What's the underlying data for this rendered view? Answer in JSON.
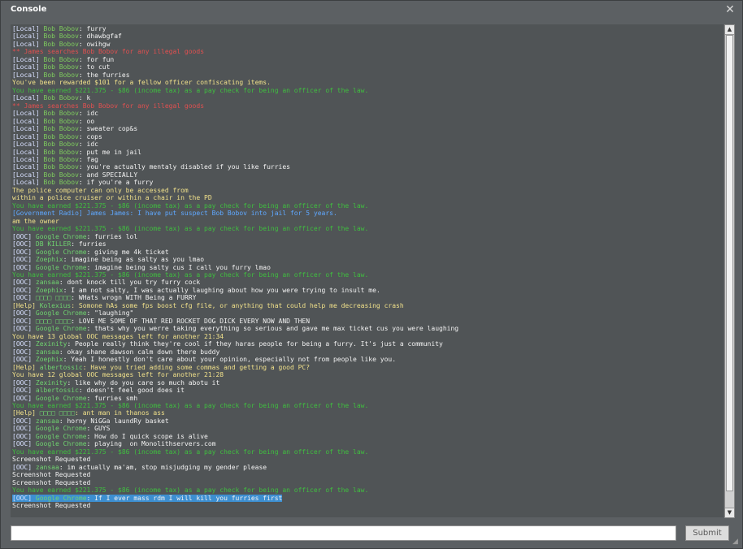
{
  "window": {
    "title": "Console",
    "close_glyph": "✕",
    "resize_glyph": "◢"
  },
  "input": {
    "value": "",
    "placeholder": ""
  },
  "submit": {
    "label": "Submit"
  },
  "scrollbar": {
    "up_glyph": "▲",
    "down_glyph": "▼"
  },
  "colors": {
    "tag": "#d8e0ff",
    "bob": "#7ecb5e",
    "name": "#6fd26f",
    "red": "#e05050",
    "yellow": "#f0e08a",
    "green": "#3fbf3f",
    "blue": "#5fa8ff",
    "white": "#f2f2f2"
  },
  "log": [
    [
      [
        "[Local] ",
        "tag"
      ],
      [
        "Bob Bobov",
        "bob"
      ],
      [
        ": furry",
        "white"
      ]
    ],
    [
      [
        "[Local] ",
        "tag"
      ],
      [
        "Bob Bobov",
        "bob"
      ],
      [
        ": dhawbgfaf",
        "white"
      ]
    ],
    [
      [
        "[Local] ",
        "tag"
      ],
      [
        "Bob Bobov",
        "bob"
      ],
      [
        ": owihgw",
        "white"
      ]
    ],
    [
      [
        "** James searches Bob Bobov for any illegal goods",
        "red"
      ]
    ],
    [
      [
        "[Local] ",
        "tag"
      ],
      [
        "Bob Bobov",
        "bob"
      ],
      [
        ": for fun",
        "white"
      ]
    ],
    [
      [
        "[Local] ",
        "tag"
      ],
      [
        "Bob Bobov",
        "bob"
      ],
      [
        ": to cut",
        "white"
      ]
    ],
    [
      [
        "[Local] ",
        "tag"
      ],
      [
        "Bob Bobov",
        "bob"
      ],
      [
        ": the furries",
        "white"
      ]
    ],
    [
      [
        "You've been rewarded $101 for a fellow officer confiscating items.",
        "yellow"
      ]
    ],
    [
      [
        "You have earned $221.375 - $86 (income tax) as a pay check for being an officer of the law.",
        "green"
      ]
    ],
    [
      [
        "[Local] ",
        "tag"
      ],
      [
        "Bob Bobov",
        "bob"
      ],
      [
        ": k",
        "white"
      ]
    ],
    [
      [
        "** James searches Bob Bobov for any illegal goods",
        "red"
      ]
    ],
    [
      [
        "[Local] ",
        "tag"
      ],
      [
        "Bob Bobov",
        "bob"
      ],
      [
        ": idc",
        "white"
      ]
    ],
    [
      [
        "[Local] ",
        "tag"
      ],
      [
        "Bob Bobov",
        "bob"
      ],
      [
        ": oo",
        "white"
      ]
    ],
    [
      [
        "[Local] ",
        "tag"
      ],
      [
        "Bob Bobov",
        "bob"
      ],
      [
        ": sweater cop&s",
        "white"
      ]
    ],
    [
      [
        "[Local] ",
        "tag"
      ],
      [
        "Bob Bobov",
        "bob"
      ],
      [
        ": cops",
        "white"
      ]
    ],
    [
      [
        "[Local] ",
        "tag"
      ],
      [
        "Bob Bobov",
        "bob"
      ],
      [
        ": idc",
        "white"
      ]
    ],
    [
      [
        "[Local] ",
        "tag"
      ],
      [
        "Bob Bobov",
        "bob"
      ],
      [
        ": put me in jail",
        "white"
      ]
    ],
    [
      [
        "[Local] ",
        "tag"
      ],
      [
        "Bob Bobov",
        "bob"
      ],
      [
        ": fag",
        "white"
      ]
    ],
    [
      [
        "[Local] ",
        "tag"
      ],
      [
        "Bob Bobov",
        "bob"
      ],
      [
        ": you're actually mentaly disabled if you like furries",
        "white"
      ]
    ],
    [
      [
        "[Local] ",
        "tag"
      ],
      [
        "Bob Bobov",
        "bob"
      ],
      [
        ": and SPECIALLY",
        "white"
      ]
    ],
    [
      [
        "[Local] ",
        "tag"
      ],
      [
        "Bob Bobov",
        "bob"
      ],
      [
        ": if you're a furry",
        "white"
      ]
    ],
    [
      [
        "The police computer can only be accessed from",
        "yellow"
      ]
    ],
    [
      [
        "within a police cruiser or within a chair in the PD",
        "yellow"
      ]
    ],
    [
      [
        "You have earned $221.375 - $86 (income tax) as a pay check for being an officer of the law.",
        "green"
      ]
    ],
    [
      [
        "[Government Radio] ",
        "blue"
      ],
      [
        "James James",
        "blue"
      ],
      [
        ": I have put suspect Bob Bobov into jail for 5 years.",
        "blue"
      ]
    ],
    [
      [
        "am the owner",
        "yellow"
      ]
    ],
    [
      [
        "You have earned $221.375 - $86 (income tax) as a pay check for being an officer of the law.",
        "green"
      ]
    ],
    [
      [
        "[OOC] ",
        "tag"
      ],
      [
        "Google Chrome",
        "name"
      ],
      [
        ": furries lol",
        "white"
      ]
    ],
    [
      [
        "[OOC] ",
        "tag"
      ],
      [
        "DB KILLER",
        "name"
      ],
      [
        ": furries",
        "white"
      ]
    ],
    [
      [
        "[OOC] ",
        "tag"
      ],
      [
        "Google Chrome",
        "name"
      ],
      [
        ": giving me 4k ticket",
        "white"
      ]
    ],
    [
      [
        "[OOC] ",
        "tag"
      ],
      [
        "Zoephix",
        "name"
      ],
      [
        ": imagine being as salty as you lmao",
        "white"
      ]
    ],
    [
      [
        "[OOC] ",
        "tag"
      ],
      [
        "Google Chrome",
        "name"
      ],
      [
        ": imagine being salty cus I call you furry lmao",
        "white"
      ]
    ],
    [
      [
        "You have earned $221.375 - $86 (income tax) as a pay check for being an officer of the law.",
        "green"
      ]
    ],
    [
      [
        "[OOC] ",
        "tag"
      ],
      [
        "zansaa",
        "name"
      ],
      [
        ": dont knock till you try furry cock",
        "white"
      ]
    ],
    [
      [
        "[OOC] ",
        "tag"
      ],
      [
        "Zoephix",
        "name"
      ],
      [
        ": I am not salty, I was actually laughing about how you were trying to insult me.",
        "white"
      ]
    ],
    [
      [
        "[OOC] ",
        "tag"
      ],
      [
        "□□□□ □□□□",
        "name"
      ],
      [
        ": WHats wrogn WITH Being a FURRY",
        "white"
      ]
    ],
    [
      [
        "[Help] ",
        "yellow"
      ],
      [
        "Kolexius",
        "name"
      ],
      [
        ": Somone hAs some fps boost cfg file, or anything that could help me decreasing crash",
        "yellow"
      ]
    ],
    [
      [
        "[OOC] ",
        "tag"
      ],
      [
        "Google Chrome",
        "name"
      ],
      [
        ": \"laughing\"",
        "white"
      ]
    ],
    [
      [
        "[OOC] ",
        "tag"
      ],
      [
        "□□□□ □□□□",
        "name"
      ],
      [
        ": LOVE ME SOME OF THAT RED ROCKET DOG DICK EVERY NOW AND THEN",
        "white"
      ]
    ],
    [
      [
        "[OOC] ",
        "tag"
      ],
      [
        "Google Chrome",
        "name"
      ],
      [
        ": thats why you werre taking everything so serious and gave me max ticket cus you were laughing",
        "white"
      ]
    ],
    [
      [
        "You have 13 global OOC messages left for another 21:34",
        "yellow"
      ]
    ],
    [
      [
        "[OOC] ",
        "tag"
      ],
      [
        "Zexinity",
        "name"
      ],
      [
        ": People really think they're cool if they haras people for being a furry. It's just a community",
        "white"
      ]
    ],
    [
      [
        "[OOC] ",
        "tag"
      ],
      [
        "zansaa",
        "name"
      ],
      [
        ": okay shane dawson calm down there buddy",
        "white"
      ]
    ],
    [
      [
        "[OOC] ",
        "tag"
      ],
      [
        "Zoephix",
        "name"
      ],
      [
        ": Yeah I honestly don't care about your opinion, especially not from people like you.",
        "white"
      ]
    ],
    [
      [
        "[Help] ",
        "yellow"
      ],
      [
        "albertossic",
        "name"
      ],
      [
        ": Have you tried adding some commas and getting a good PC?",
        "yellow"
      ]
    ],
    [
      [
        "You have 12 global OOC messages left for another 21:28",
        "yellow"
      ]
    ],
    [
      [
        "[OOC] ",
        "tag"
      ],
      [
        "Zexinity",
        "name"
      ],
      [
        ": like why do you care so much abotu it",
        "white"
      ]
    ],
    [
      [
        "[OOC] ",
        "tag"
      ],
      [
        "albertossic",
        "name"
      ],
      [
        ": doesn't feel good does it",
        "white"
      ]
    ],
    [
      [
        "[OOC] ",
        "tag"
      ],
      [
        "Google Chrome",
        "name"
      ],
      [
        ": furries smh",
        "white"
      ]
    ],
    [
      [
        "You have earned $221.375 - $86 (income tax) as a pay check for being an officer of the law.",
        "green"
      ]
    ],
    [
      [
        "[Help] ",
        "yellow"
      ],
      [
        "□□□□ □□□□",
        "name"
      ],
      [
        ": ant man in thanos ass",
        "yellow"
      ]
    ],
    [
      [
        "[OOC] ",
        "tag"
      ],
      [
        "zansaa",
        "name"
      ],
      [
        ": horny NiGGa laundRy basket",
        "white"
      ]
    ],
    [
      [
        "[OOC] ",
        "tag"
      ],
      [
        "Google Chrome",
        "name"
      ],
      [
        ": GUYS",
        "white"
      ]
    ],
    [
      [
        "[OOC] ",
        "tag"
      ],
      [
        "Google Chrome",
        "name"
      ],
      [
        ": How do I quick scope is alive",
        "white"
      ]
    ],
    [
      [
        "[OOC] ",
        "tag"
      ],
      [
        "Google Chrome",
        "name"
      ],
      [
        ": playing  on Monolithservers.com",
        "white"
      ]
    ],
    [
      [
        "You have earned $221.375 - $86 (income tax) as a pay check for being an officer of the law.",
        "green"
      ]
    ],
    [
      [
        "Screenshot Requested",
        "white"
      ]
    ],
    [
      [
        "[OOC] ",
        "tag"
      ],
      [
        "zansaa",
        "name"
      ],
      [
        ": im actually ma'am, stop misjudging my gender please",
        "white"
      ]
    ],
    [
      [
        "Screenshot Requested",
        "white"
      ]
    ],
    [
      [
        "Screenshot Requested",
        "white"
      ]
    ],
    [
      [
        "You have earned $221.375 - $86 (income tax) as a pay check for being an officer of the law.",
        "green"
      ]
    ],
    [
      [
        "[OOC] ",
        "tag"
      ],
      [
        "Google Chrome",
        "name"
      ],
      [
        ": If I ever mass rdm I will kill you furries first",
        "white"
      ]
    ],
    [
      [
        "Screenshot Requested",
        "white"
      ]
    ]
  ],
  "selected_line": 61
}
